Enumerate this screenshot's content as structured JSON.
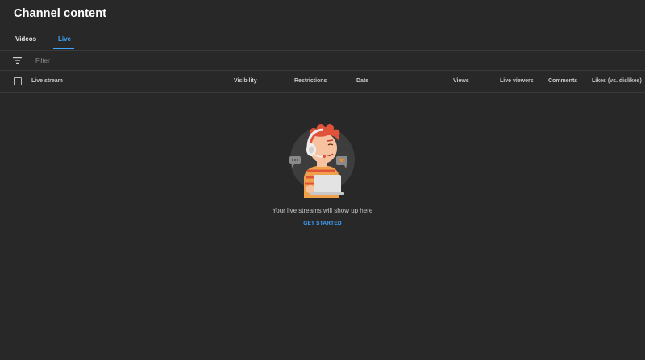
{
  "header": {
    "title": "Channel content"
  },
  "tabs": [
    {
      "label": "Videos",
      "active": false
    },
    {
      "label": "Live",
      "active": true
    }
  ],
  "filter": {
    "placeholder": "Filter",
    "value": "",
    "icon": "filter-icon"
  },
  "table": {
    "columns": [
      "Live stream",
      "Visibility",
      "Restrictions",
      "Date",
      "Views",
      "Live viewers",
      "Comments",
      "Likes (vs. dislikes)"
    ]
  },
  "empty_state": {
    "illustration": "streamer-with-headset-illustration",
    "message": "Your live streams will show up here",
    "action_label": "GET STARTED"
  },
  "colors": {
    "background": "#282828",
    "accent": "#3ea6ff",
    "divider": "#3a3a3a"
  }
}
